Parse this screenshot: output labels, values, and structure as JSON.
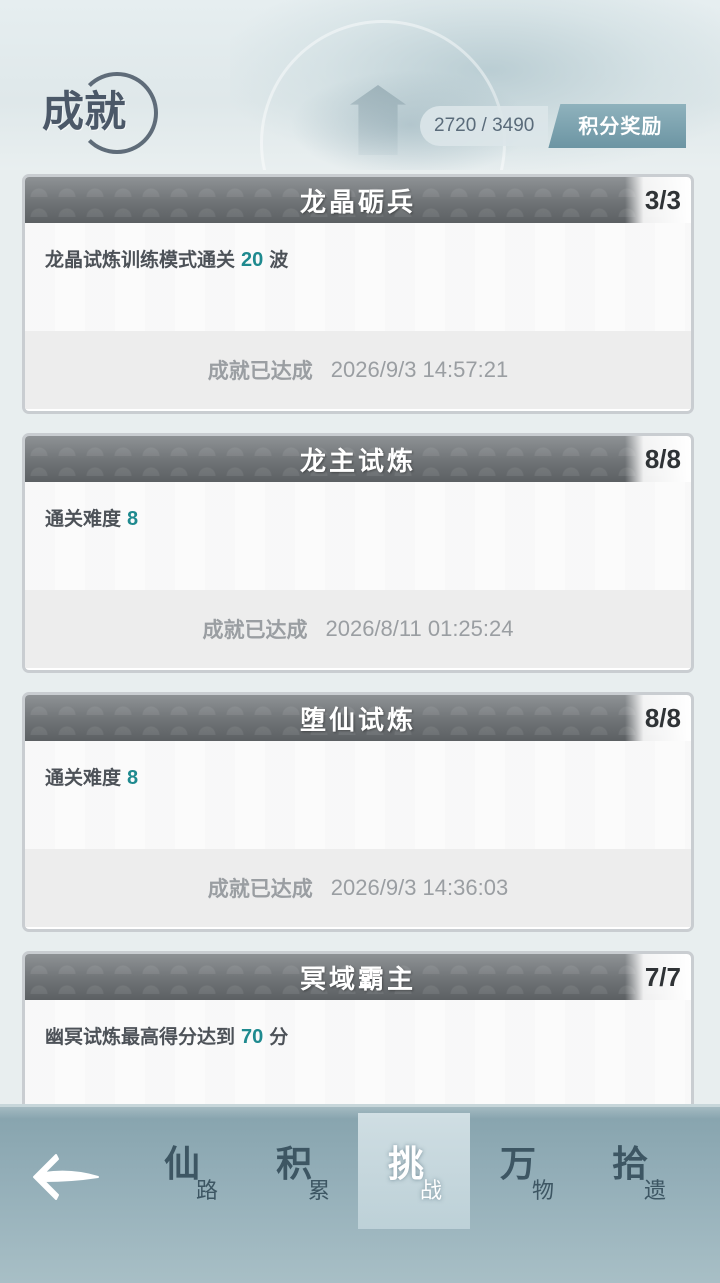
{
  "header": {
    "title": "成就",
    "points_text": "2720 / 3490",
    "reward_button_label": "积分奖励"
  },
  "achievements": [
    {
      "name": "龙晶砺兵",
      "progress": "3/3",
      "desc_prefix": "龙晶试炼训练模式通关",
      "desc_value": "20",
      "desc_suffix": "波",
      "status": "成就已达成",
      "time": "2026/9/3 14:57:21"
    },
    {
      "name": "龙主试炼",
      "progress": "8/8",
      "desc_prefix": "通关难度",
      "desc_value": "8",
      "desc_suffix": "",
      "status": "成就已达成",
      "time": "2026/8/11 01:25:24"
    },
    {
      "name": "堕仙试炼",
      "progress": "8/8",
      "desc_prefix": "通关难度",
      "desc_value": "8",
      "desc_suffix": "",
      "status": "成就已达成",
      "time": "2026/9/3 14:36:03"
    },
    {
      "name": "冥域霸主",
      "progress": "7/7",
      "desc_prefix": "幽冥试炼最高得分达到",
      "desc_value": "70",
      "desc_suffix": "分"
    }
  ],
  "bottom_nav": {
    "back_icon": "back-arrow-icon",
    "tabs": [
      {
        "big": "仙",
        "small": "路",
        "active": false
      },
      {
        "big": "积",
        "small": "累",
        "active": false
      },
      {
        "big": "挑",
        "small": "战",
        "active": true
      },
      {
        "big": "万",
        "small": "物",
        "active": false
      },
      {
        "big": "拾",
        "small": "遗",
        "active": false
      }
    ]
  },
  "colors": {
    "accent_value": "#1f8a8f",
    "card_header": "#74787b",
    "nav_bg": "#8fa9b3",
    "reward_button": "#7ba2af"
  }
}
